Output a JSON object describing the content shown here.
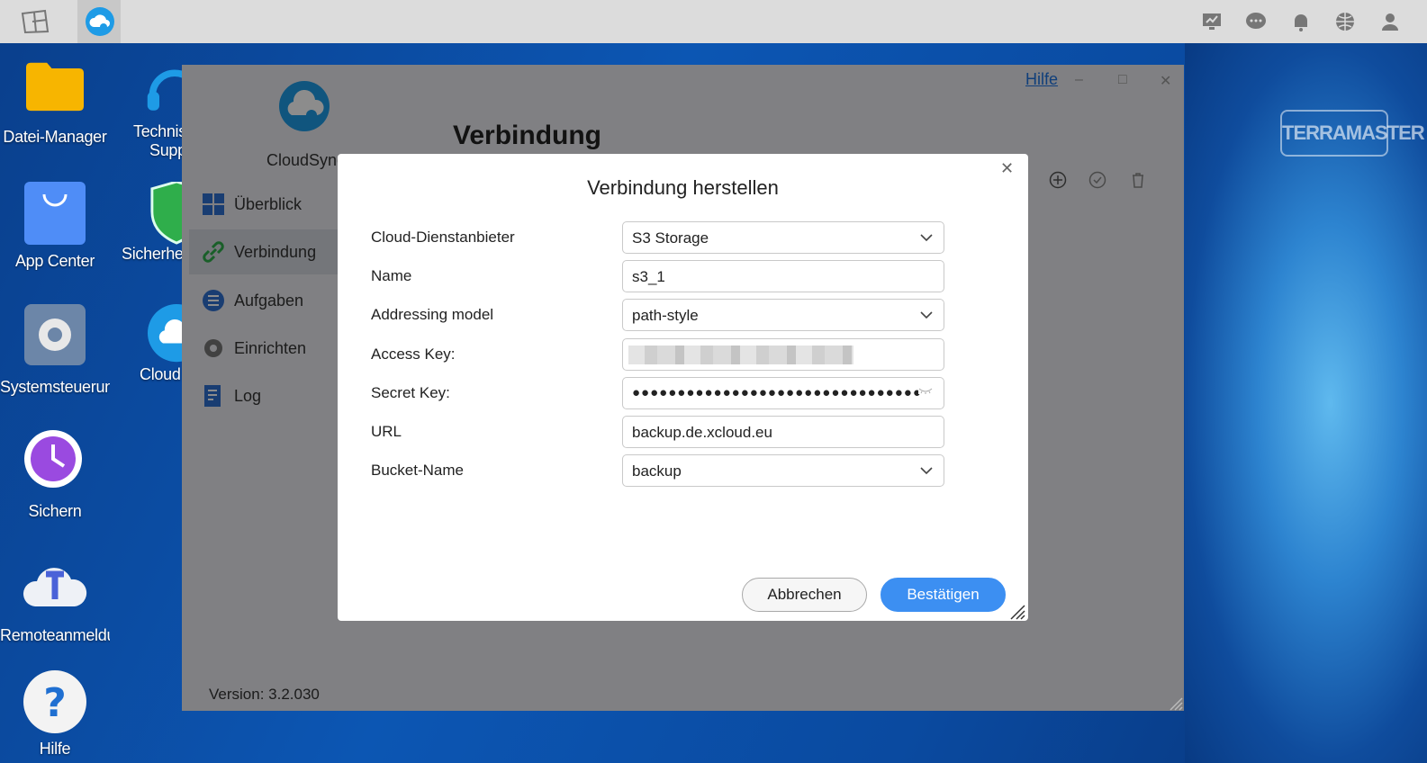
{
  "desktop": {
    "left_icons": [
      {
        "label": "Datei-Manager"
      },
      {
        "label": "App Center"
      },
      {
        "label": "Systemsteuerun"
      },
      {
        "label": "Sichern"
      },
      {
        "label": "Remoteanmeldu"
      },
      {
        "label": "Hilfe"
      }
    ],
    "right_icons": [
      {
        "label": "Technis",
        "label2": "Supp"
      },
      {
        "label": "Sicherhe"
      },
      {
        "label": "Cloud"
      }
    ],
    "brand": "TERRAMASTER"
  },
  "taskbar": {
    "right_icons": [
      "monitor-icon",
      "chat-icon",
      "bell-icon",
      "globe-icon",
      "user-icon"
    ]
  },
  "app": {
    "name": "CloudSync",
    "title": "Verbindung",
    "help": "Hilfe",
    "version": "Version: 3.2.030",
    "nav": [
      {
        "label": "Überblick",
        "icon": "grid-icon",
        "active": false
      },
      {
        "label": "Verbindung",
        "icon": "link-icon",
        "active": true
      },
      {
        "label": "Aufgaben",
        "icon": "list-icon",
        "active": false
      },
      {
        "label": "Einrichten",
        "icon": "gear-icon",
        "active": false
      },
      {
        "label": "Log",
        "icon": "log-icon",
        "active": false
      }
    ]
  },
  "dialog": {
    "title": "Verbindung herstellen",
    "fields": {
      "provider_label": "Cloud-Dienstanbieter",
      "provider_value": "S3 Storage",
      "name_label": "Name",
      "name_value": "s3_1",
      "addressing_label": "Addressing model",
      "addressing_value": "path-style",
      "access_key_label": "Access Key:",
      "secret_key_label": "Secret Key:",
      "secret_key_value": "●●●●●●●●●●●●●●●●●●●●●●●●●●●●●●●●",
      "url_label": "URL",
      "url_value": "backup.de.xcloud.eu",
      "bucket_label": "Bucket-Name",
      "bucket_value": "backup"
    },
    "cancel": "Abbrechen",
    "confirm": "Bestätigen"
  }
}
